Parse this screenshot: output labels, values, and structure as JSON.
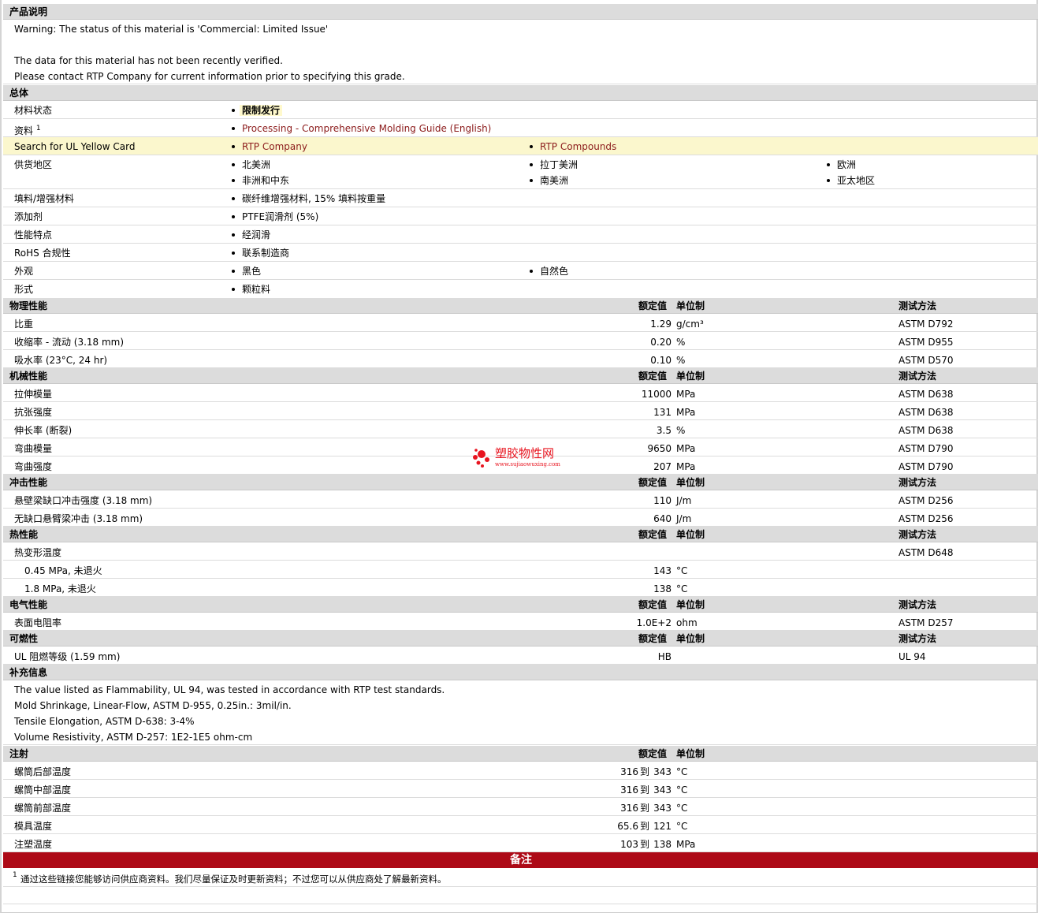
{
  "desc_section": {
    "title": "产品说明",
    "warning": "Warning: The status of this material is 'Commercial: Limited Issue'",
    "not_verified": "The data for this material has not been recently verified.",
    "contact": "Please contact RTP Company for current information prior to specifying this grade."
  },
  "general": {
    "title": "总体",
    "material_status": {
      "label": "材料状态",
      "value": "限制发行"
    },
    "resources": {
      "label": "资料",
      "footnote": "1",
      "link": "Processing - Comprehensive Molding Guide (English)"
    },
    "ul_card": {
      "label": "Search for UL Yellow Card",
      "link1": "RTP Company",
      "link2": "RTP Compounds"
    },
    "regions": {
      "label": "供货地区",
      "items": [
        "北美洲",
        "拉丁美洲",
        "欧洲",
        "非洲和中东",
        "南美洲",
        "亚太地区"
      ]
    },
    "filler": {
      "label": "填料/增强材料",
      "value": "碳纤维增强材料, 15% 填料按重量"
    },
    "additive": {
      "label": "添加剂",
      "value": "PTFE润滑剂 (5%)"
    },
    "features": {
      "label": "性能特点",
      "value": "经润滑"
    },
    "rohs": {
      "label": "RoHS 合规性",
      "value": "联系制造商"
    },
    "appearance": {
      "label": "外观",
      "value1": "黑色",
      "value2": "自然色"
    },
    "form": {
      "label": "形式",
      "value": "颗粒料"
    }
  },
  "headers": {
    "nominal": "额定值",
    "unit": "单位制",
    "method": "测试方法"
  },
  "physical": {
    "title": "物理性能",
    "rows": [
      {
        "label": "比重",
        "value": "1.29",
        "unit": "g/cm³",
        "method": "ASTM D792"
      },
      {
        "label": "收缩率  - 流动  (3.18 mm)",
        "value": "0.20",
        "unit": "%",
        "method": "ASTM D955"
      },
      {
        "label": "吸水率  (23°C, 24 hr)",
        "value": "0.10",
        "unit": "%",
        "method": "ASTM D570"
      }
    ]
  },
  "mechanical": {
    "title": "机械性能",
    "rows": [
      {
        "label": "拉伸模量",
        "value": "11000",
        "unit": "MPa",
        "method": "ASTM D638"
      },
      {
        "label": "抗张强度",
        "value": "131",
        "unit": "MPa",
        "method": "ASTM D638"
      },
      {
        "label": "伸长率  (断裂)",
        "value": "3.5",
        "unit": "%",
        "method": "ASTM D638"
      },
      {
        "label": "弯曲模量",
        "value": "9650",
        "unit": "MPa",
        "method": "ASTM D790"
      },
      {
        "label": "弯曲强度",
        "value": "207",
        "unit": "MPa",
        "method": "ASTM D790"
      }
    ]
  },
  "impact": {
    "title": "冲击性能",
    "rows": [
      {
        "label": "悬壁梁缺口冲击强度  (3.18 mm)",
        "value": "110",
        "unit": "J/m",
        "method": "ASTM D256"
      },
      {
        "label": "无缺口悬臂梁冲击  (3.18 mm)",
        "value": "640",
        "unit": "J/m",
        "method": "ASTM D256"
      }
    ]
  },
  "thermal": {
    "title": "热性能",
    "rows": [
      {
        "label": "热变形温度",
        "value": "",
        "unit": "",
        "method": "ASTM D648"
      },
      {
        "label": "0.45 MPa, 未退火",
        "value": "143",
        "unit": "°C",
        "method": ""
      },
      {
        "label": "1.8 MPa, 未退火",
        "value": "138",
        "unit": "°C",
        "method": ""
      }
    ]
  },
  "electrical": {
    "title": "电气性能",
    "rows": [
      {
        "label": "表面电阻率",
        "value": "1.0E+2",
        "unit": "ohm",
        "method": "ASTM D257"
      }
    ]
  },
  "flammability": {
    "title": "可燃性",
    "rows": [
      {
        "label": "UL 阻燃等级  (1.59 mm)",
        "value": "HB",
        "unit": "",
        "method": "UL 94"
      }
    ]
  },
  "supplemental": {
    "title": "补充信息",
    "lines": [
      "The value listed as Flammability, UL 94, was tested in accordance with RTP test standards.",
      "Mold Shrinkage, Linear-Flow, ASTM D-955, 0.25in.: 3mil/in.",
      "Tensile Elongation, ASTM D-638: 3-4%",
      "Volume Resistivity, ASTM D-257: 1E2-1E5 ohm-cm"
    ]
  },
  "injection": {
    "title": "注射",
    "to": "到",
    "rows": [
      {
        "label": "螺筒后部温度",
        "min": "316",
        "max": "343",
        "unit": "°C"
      },
      {
        "label": "螺筒中部温度",
        "min": "316",
        "max": "343",
        "unit": "°C"
      },
      {
        "label": "螺筒前部温度",
        "min": "316",
        "max": "343",
        "unit": "°C"
      },
      {
        "label": "模具温度",
        "min": "65.6",
        "max": "121",
        "unit": "°C"
      },
      {
        "label": "注塑温度",
        "min": "103",
        "max": "138",
        "unit": "MPa"
      }
    ]
  },
  "notes": {
    "title": "备注",
    "footnote_num": "1",
    "footnote": "通过这些链接您能够访问供应商资料。我们尽量保证及时更新资料；不过您可以从供应商处了解最新资料。"
  },
  "watermark": {
    "name": "塑胶物性网",
    "url": "www.sujiaowuxing.com",
    "color": "#e8141f"
  }
}
